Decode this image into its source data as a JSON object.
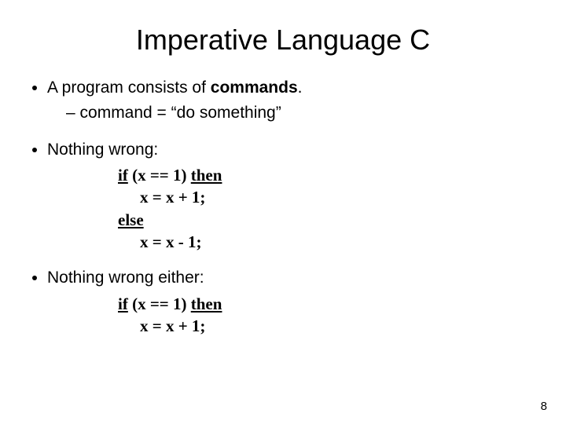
{
  "title": "Imperative Language C",
  "bullets": {
    "b1": {
      "pre": "A program consists of ",
      "bold": "commands",
      "post": ".",
      "sub1": "command = “do something”"
    },
    "b2": {
      "label": "Nothing wrong:"
    },
    "b3": {
      "label": "Nothing wrong either:"
    }
  },
  "code1": {
    "l1_kw1": "if",
    "l1_mid": " (x == 1) ",
    "l1_kw2": "then",
    "l2": "x = x + 1;",
    "l3_kw": "else",
    "l4": "x = x - 1;"
  },
  "code2": {
    "l1_kw1": "if",
    "l1_mid": " (x == 1) ",
    "l1_kw2": "then",
    "l2": "x = x + 1;"
  },
  "page_number": "8"
}
